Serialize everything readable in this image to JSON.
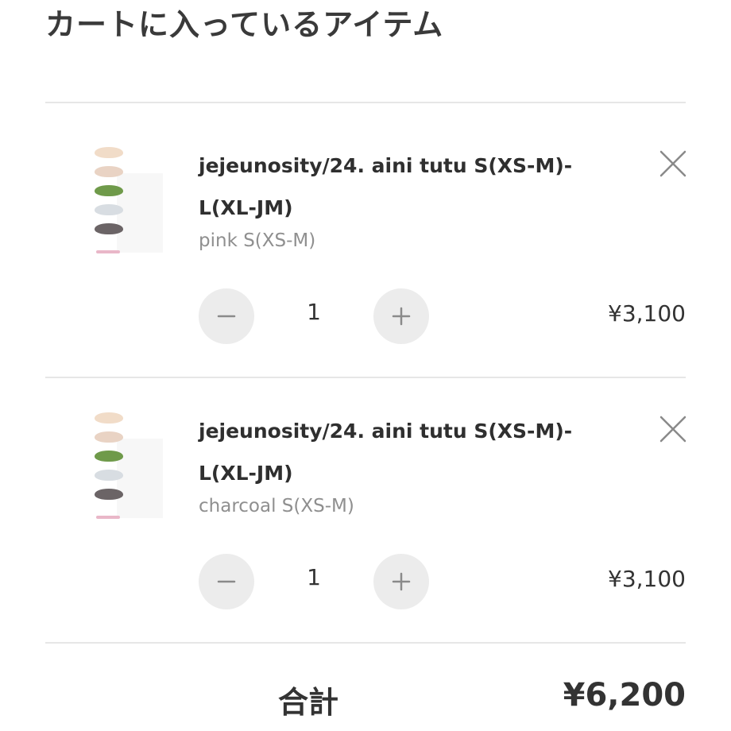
{
  "header": {
    "title": "カートに入っているアイテム"
  },
  "cart": {
    "items": [
      {
        "name": "jejeunosity/24. aini tutu S(XS-M)-L(XL-JM)",
        "variant": "pink S(XS-M)",
        "quantity": "1",
        "price": "¥3,100",
        "thumbnail_colors": [
          "#f1dcc8",
          "#e9d3c4",
          "#6f9a4a",
          "#d8dde2",
          "#6b6466"
        ]
      },
      {
        "name": "jejeunosity/24. aini tutu S(XS-M)-L(XL-JM)",
        "variant": "charcoal S(XS-M)",
        "quantity": "1",
        "price": "¥3,100",
        "thumbnail_colors": [
          "#f1dcc8",
          "#e9d3c4",
          "#6f9a4a",
          "#d8dde2",
          "#6b6466"
        ]
      }
    ]
  },
  "summary": {
    "total_label": "合計",
    "total_value": "¥6,200"
  },
  "icons": {
    "remove": "close-icon",
    "decrease": "minus-icon",
    "increase": "plus-icon"
  },
  "colors": {
    "text": "#333333",
    "muted": "#8f8f8f",
    "button_bg": "#ececec",
    "divider": "#e6e6e6"
  }
}
